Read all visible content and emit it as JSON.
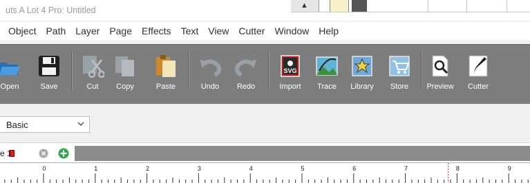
{
  "app": {
    "title": "uts A Lot 4 Pro: Untitled"
  },
  "menu": {
    "items": [
      "Object",
      "Path",
      "Layer",
      "Page",
      "Effects",
      "Text",
      "View",
      "Cutter",
      "Window",
      "Help"
    ]
  },
  "toolbar": {
    "tools": [
      {
        "label": "Open",
        "icon": "open-icon"
      },
      {
        "label": "Save",
        "icon": "save-icon"
      },
      {
        "label": "Cut",
        "icon": "cut-icon"
      },
      {
        "label": "Copy",
        "icon": "copy-icon"
      },
      {
        "label": "Paste",
        "icon": "paste-icon"
      },
      {
        "label": "Undo",
        "icon": "undo-icon"
      },
      {
        "label": "Redo",
        "icon": "redo-icon"
      },
      {
        "label": "Import",
        "icon": "import-svg-icon",
        "icon_text": "SVG"
      },
      {
        "label": "Trace",
        "icon": "trace-icon"
      },
      {
        "label": "Library",
        "icon": "library-icon"
      },
      {
        "label": "Store",
        "icon": "store-cart-icon"
      },
      {
        "label": "Preview",
        "icon": "preview-magnifier-icon"
      },
      {
        "label": "Cutter",
        "icon": "cutter-knife-icon"
      }
    ]
  },
  "style_row": {
    "style_select_value": "Basic"
  },
  "page_tabs": {
    "current_tab_label": "e 1",
    "swatch_color": "#e01c1c"
  },
  "ruler": {
    "ticks": [
      "0",
      "1",
      "2",
      "3",
      "4",
      "5",
      "6",
      "7",
      "8",
      "9"
    ],
    "cursor_position": 7.83
  },
  "colors": {
    "toolbar_bg": "#7d7d7d",
    "tab_strip": "#8c8c8c",
    "add_green": "#2ea84a"
  }
}
